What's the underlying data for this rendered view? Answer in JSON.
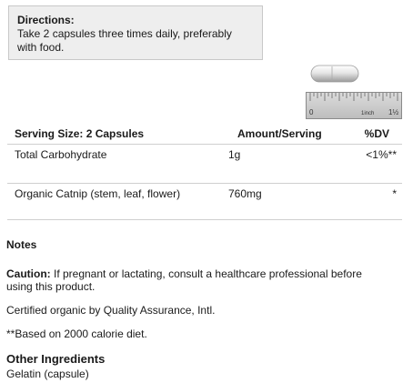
{
  "directions": {
    "title": "Directions:",
    "text": "Take 2 capsules three times daily, preferably with food."
  },
  "capsule_graphic": {
    "ruler_start": "0",
    "ruler_unit": "1inch",
    "ruler_end": "1½"
  },
  "supplement_facts": {
    "headers": {
      "serving_size": "Serving Size: 2 Capsules",
      "amount": "Amount/Serving",
      "dv": "%DV"
    },
    "rows": [
      {
        "name": "Total Carbohydrate",
        "amount": "1g",
        "dv": "<1%**"
      },
      {
        "name": "Organic Catnip (stem, leaf, flower)",
        "amount": "760mg",
        "dv": "*"
      }
    ]
  },
  "notes": {
    "heading": "Notes",
    "caution_label": "Caution:",
    "caution_text": " If pregnant or lactating, consult a healthcare professional before using this product.",
    "certified": "Certified organic by Quality Assurance, Intl.",
    "footnote": "**Based on 2000 calorie diet."
  },
  "other_ingredients": {
    "heading": "Other Ingredients",
    "text": "Gelatin (capsule)"
  }
}
